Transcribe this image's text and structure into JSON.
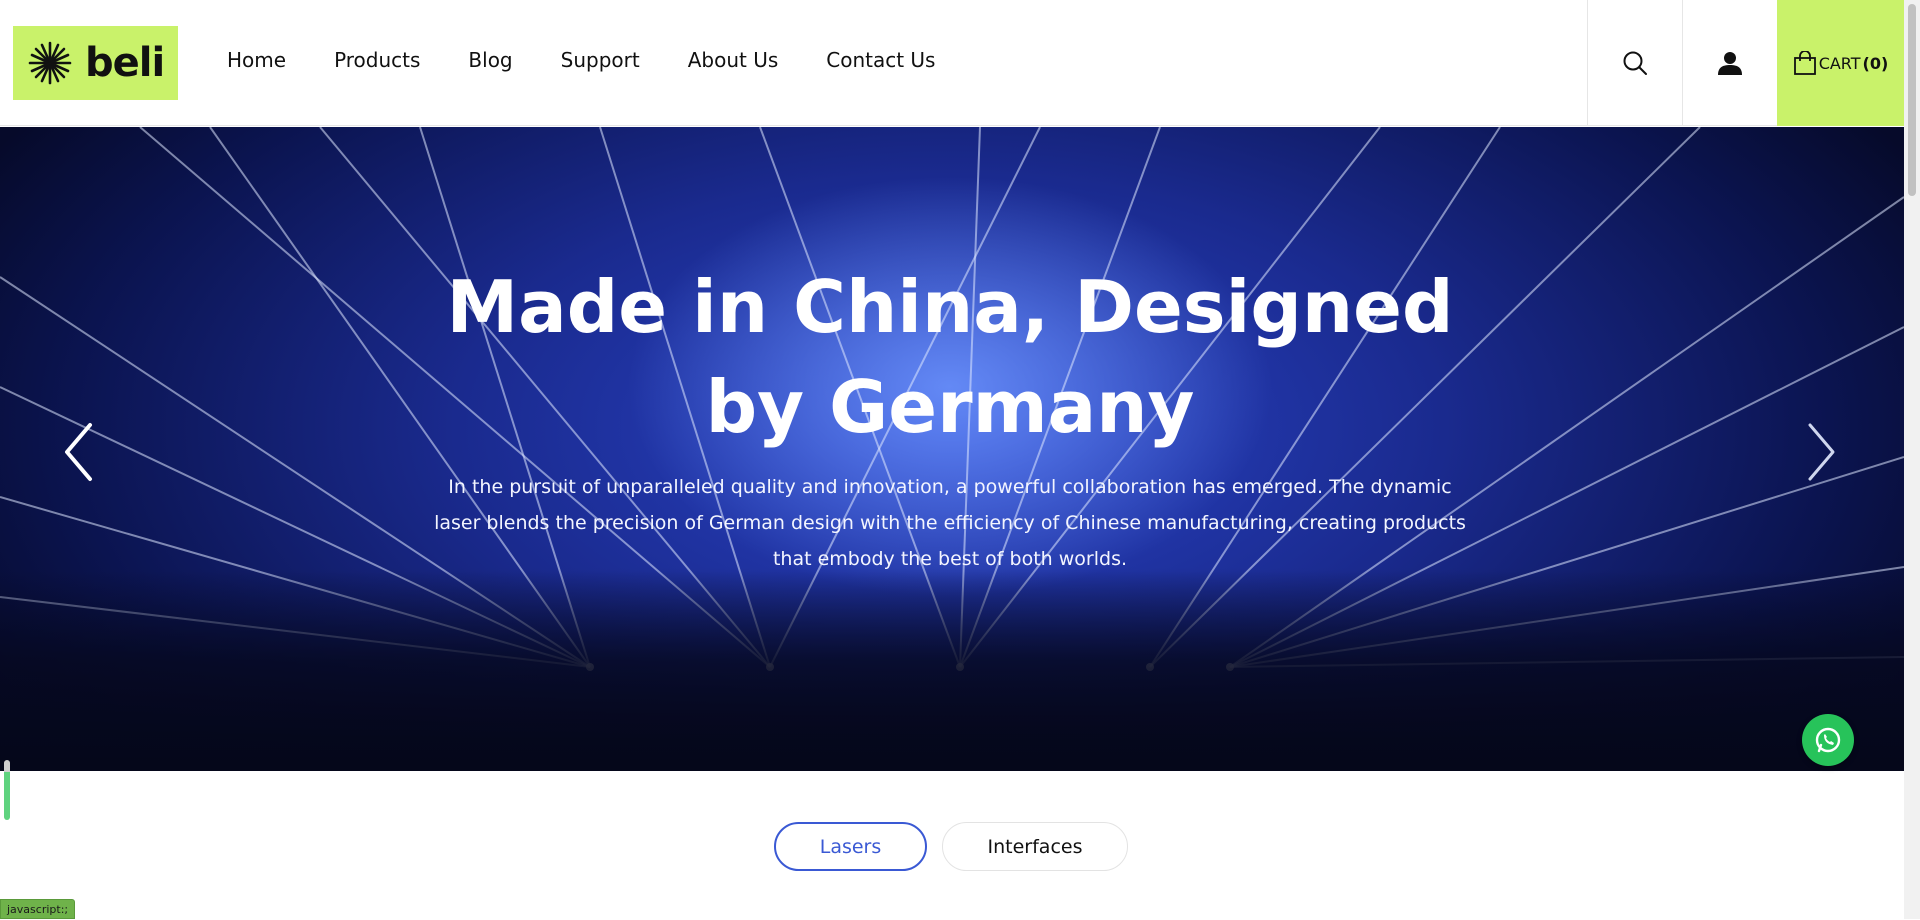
{
  "brand": {
    "logo_text": "beli",
    "logo_bg": "#c9f26a"
  },
  "nav": {
    "items": [
      "Home",
      "Products",
      "Blog",
      "Support",
      "About Us",
      "Contact Us"
    ]
  },
  "header_icons": {
    "search": "search-icon",
    "account": "user-icon",
    "cart_icon": "shopping-bag-icon"
  },
  "cart": {
    "label": "CART",
    "count": "(0)"
  },
  "hero": {
    "title": "Made in China, Designed by Germany",
    "text": "In the pursuit of unparalleled quality and innovation, a powerful collaboration has emerged. The dynamic laser blends the precision of German design with the efficiency of Chinese manufacturing, creating products that embody the best of both worlds.",
    "prev_icon": "chevron-left-icon",
    "next_icon": "chevron-right-icon"
  },
  "whatsapp": {
    "icon": "whatsapp-icon",
    "color": "#27c35a"
  },
  "tabs": [
    {
      "label": "Lasers",
      "active": true
    },
    {
      "label": "Interfaces",
      "active": false
    }
  ],
  "status_bar": {
    "text": "javascript:;"
  },
  "colors": {
    "accent": "#c9f26a",
    "tab_active": "#3a59d4"
  }
}
